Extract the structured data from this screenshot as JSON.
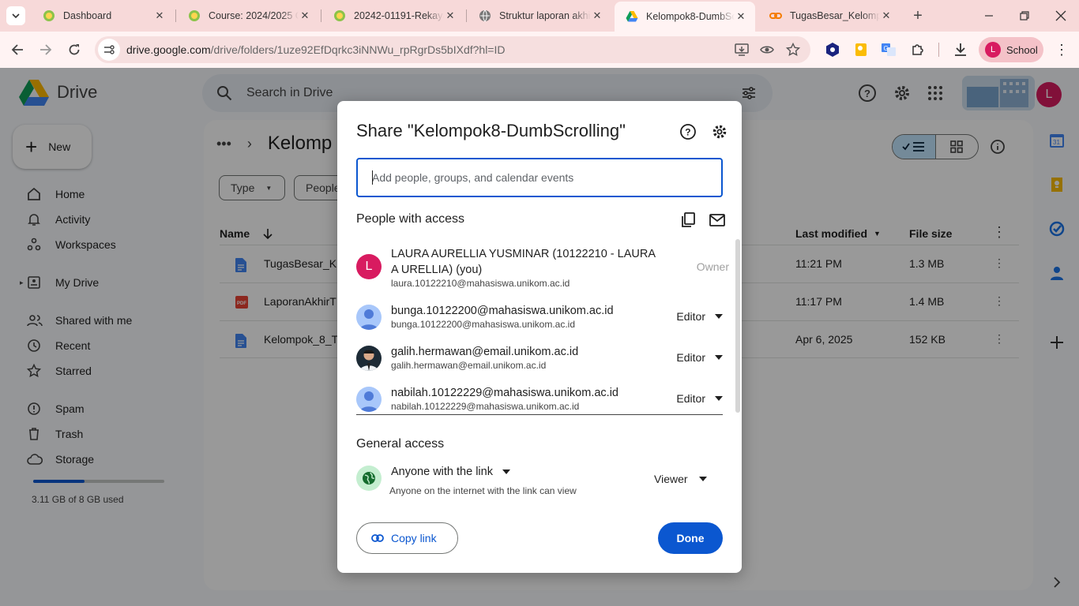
{
  "browser": {
    "tabs": [
      {
        "title": "Dashboard",
        "favicon": "moodle-icon"
      },
      {
        "title": "Course: 2024/2025 Ge",
        "favicon": "moodle-icon"
      },
      {
        "title": "20242-01191-Rekayas",
        "favicon": "moodle-icon"
      },
      {
        "title": "Struktur laporan akhi",
        "favicon": "globe-icon"
      },
      {
        "title": "Kelompok8-DumbScr",
        "favicon": "drive-icon",
        "active": true
      },
      {
        "title": "TugasBesar_Kelompo",
        "favicon": "link-icon"
      }
    ],
    "url_domain": "drive.google.com",
    "url_path": "/drive/folders/1uze92EfDqrkc3iNNWu_rpRgrDs5bIXdf?hl=ID",
    "profile_label": "School",
    "profile_initial": "L"
  },
  "drive": {
    "logo_text": "Drive",
    "search_placeholder": "Search in Drive",
    "new_label": "New",
    "nav": [
      {
        "label": "Home",
        "icon": "home-icon"
      },
      {
        "label": "Activity",
        "icon": "bell-icon"
      },
      {
        "label": "Workspaces",
        "icon": "workspaces-icon"
      },
      {
        "label": "My Drive",
        "icon": "my-drive-icon"
      },
      {
        "label": "Shared with me",
        "icon": "people-icon"
      },
      {
        "label": "Recent",
        "icon": "clock-icon"
      },
      {
        "label": "Starred",
        "icon": "star-icon"
      },
      {
        "label": "Spam",
        "icon": "spam-icon"
      },
      {
        "label": "Trash",
        "icon": "trash-icon"
      },
      {
        "label": "Storage",
        "icon": "cloud-icon"
      }
    ],
    "storage_used_fraction": 0.39,
    "storage_text": "3.11 GB of 8 GB used",
    "breadcrumb_current": "Kelomp",
    "filters": {
      "type": "Type",
      "people": "People"
    },
    "columns": {
      "name": "Name",
      "last_modified": "Last modified",
      "file_size": "File size"
    },
    "files": [
      {
        "name": "TugasBesar_K",
        "modified": "11:21 PM",
        "size": "1.3 MB",
        "icon": "docs-icon"
      },
      {
        "name": "LaporanAkhirT",
        "modified": "11:17 PM",
        "size": "1.4 MB",
        "icon": "pdf-icon"
      },
      {
        "name": "Kelompok_8_T",
        "modified": "Apr 6, 2025",
        "size": "152 KB",
        "icon": "docs-icon"
      }
    ],
    "user_initial": "L"
  },
  "share_dialog": {
    "title": "Share \"Kelompok8-DumbScrolling\"",
    "add_placeholder": "Add people, groups, and calendar events",
    "people_with_access": "People with access",
    "people": [
      {
        "name": "LAURA AURELLIA YUSMINAR (10122210 - LAURA A URELLIA) (you)",
        "email": "laura.10122210@mahasiswa.unikom.ac.id",
        "role": "Owner",
        "avatar": "initial",
        "initial": "L"
      },
      {
        "name": "bunga.10122200@mahasiswa.unikom.ac.id",
        "email": "bunga.10122200@mahasiswa.unikom.ac.id",
        "role": "Editor",
        "avatar": "default"
      },
      {
        "name": "galih.hermawan@email.unikom.ac.id",
        "email": "galih.hermawan@email.unikom.ac.id",
        "role": "Editor",
        "avatar": "photo"
      },
      {
        "name": "nabilah.10122229@mahasiswa.unikom.ac.id",
        "email": "nabilah.10122229@mahasiswa.unikom.ac.id",
        "role": "Editor",
        "avatar": "default"
      }
    ],
    "general_access_title": "General access",
    "general_access_value": "Anyone with the link",
    "general_access_desc": "Anyone on the internet with the link can view",
    "general_access_role": "Viewer",
    "copy_link": "Copy link",
    "done": "Done"
  },
  "colors": {
    "accent": "#0b57d0",
    "owner_avatar": "#d81b60",
    "chrome": "#f7d9d9"
  }
}
